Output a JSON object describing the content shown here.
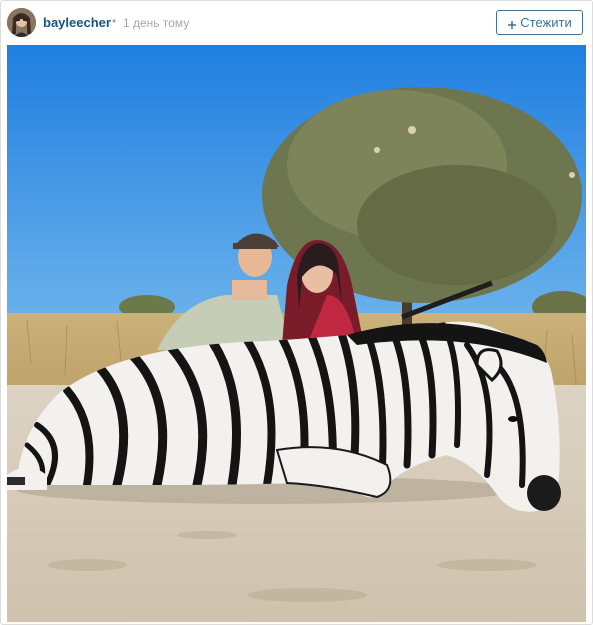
{
  "post": {
    "username": "bayleecher",
    "separator": "•",
    "timestamp": "1 день тому",
    "follow_label": "Стежити"
  },
  "icons": {
    "avatar": "user-avatar-photo",
    "follow": "plus-icon"
  },
  "colors": {
    "username": "#125688",
    "follow_border": "#3f729b",
    "timestamp": "#a8a8a8",
    "sky": "#2f8fe0"
  },
  "photo": {
    "subject": "hunting-photo-zebra"
  }
}
